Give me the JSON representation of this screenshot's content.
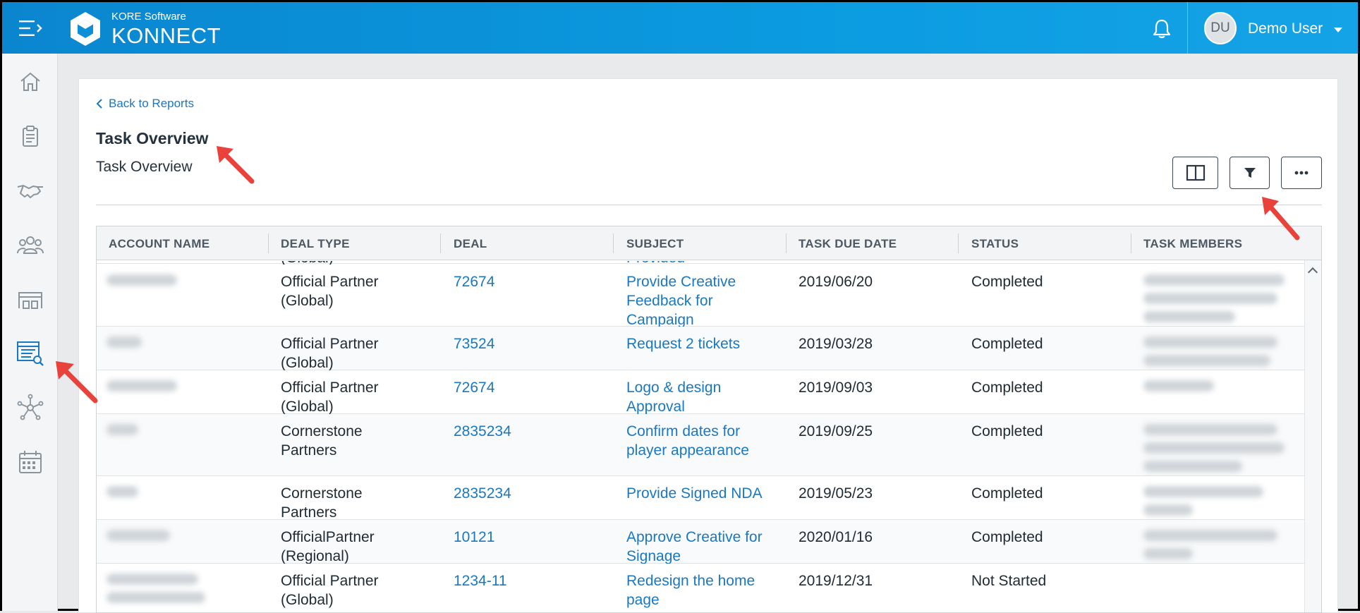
{
  "header": {
    "brand_sub": "KORE Software",
    "brand_main": "KONNECT",
    "avatar_initials": "DU",
    "username": "Demo User"
  },
  "sidebar": {
    "items": [
      {
        "name": "home-icon"
      },
      {
        "name": "clipboard-icon"
      },
      {
        "name": "handshake-icon"
      },
      {
        "name": "people-icon"
      },
      {
        "name": "warehouse-icon"
      },
      {
        "name": "reports-icon",
        "active": true
      },
      {
        "name": "network-icon"
      },
      {
        "name": "calendar-icon"
      }
    ]
  },
  "page": {
    "back_label": "Back to Reports",
    "title": "Task Overview",
    "subtitle": "Task Overview"
  },
  "table": {
    "columns": [
      "ACCOUNT NAME",
      "DEAL TYPE",
      "DEAL",
      "SUBJECT",
      "TASK DUE DATE",
      "STATUS",
      "TASK MEMBERS"
    ],
    "partial_row": {
      "deal_type": "(Global)",
      "subject": "Provided"
    },
    "rows": [
      {
        "deal_type": "Official Partner (Global)",
        "deal": "72674",
        "subject": "Provide Creative Feedback for Campaign",
        "due": "2019/06/20",
        "status": "Completed"
      },
      {
        "deal_type": "Official Partner (Global)",
        "deal": "73524",
        "subject": "Request 2 tickets",
        "due": "2019/03/28",
        "status": "Completed"
      },
      {
        "deal_type": "Official Partner (Global)",
        "deal": "72674",
        "subject": "Logo & design Approval",
        "due": "2019/09/03",
        "status": "Completed"
      },
      {
        "deal_type": "Cornerstone Partners",
        "deal": "2835234",
        "subject": "Confirm dates for player appearance",
        "due": "2019/09/25",
        "status": "Completed"
      },
      {
        "deal_type": "Cornerstone Partners",
        "deal": "2835234",
        "subject": "Provide Signed NDA",
        "due": "2019/05/23",
        "status": "Completed"
      },
      {
        "deal_type": "OfficialPartner (Regional)",
        "deal": "10121",
        "subject": "Approve Creative for Signage",
        "due": "2020/01/16",
        "status": "Completed"
      },
      {
        "deal_type": "Official Partner (Global)",
        "deal": "1234-11",
        "subject": "Redesign the home page",
        "due": "2019/12/31",
        "status": "Not Started"
      }
    ]
  },
  "colors": {
    "header_blue": "#0b9be0",
    "link_blue": "#1a78c2",
    "arrow_red": "#e8423a"
  }
}
